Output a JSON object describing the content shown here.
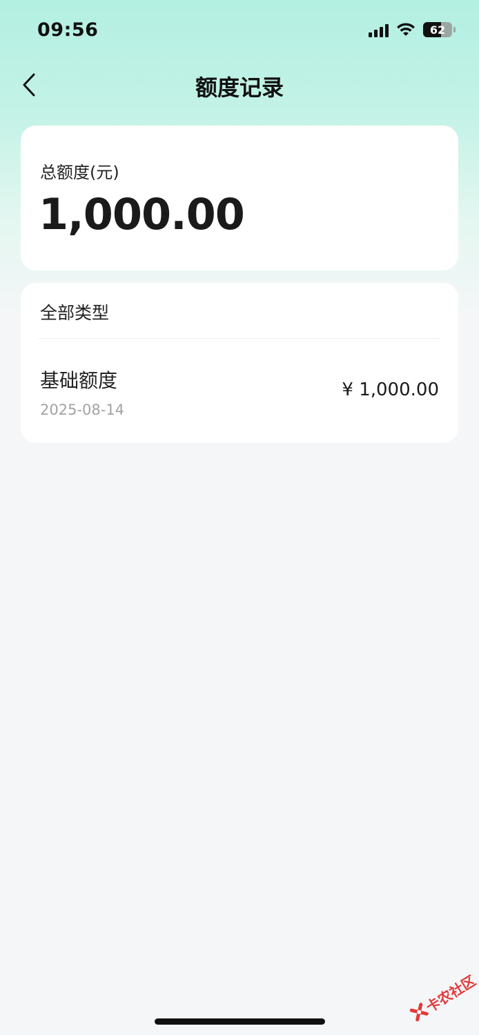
{
  "status_bar": {
    "time": "09:56",
    "battery_level": "62",
    "icons": [
      "signal-icon",
      "wifi-icon",
      "battery-icon"
    ]
  },
  "nav": {
    "back_icon": "chevron-left-icon",
    "title": "额度记录"
  },
  "total": {
    "label": "总额度(元)",
    "amount": "1,000.00"
  },
  "records": {
    "filter_label": "全部类型",
    "items": [
      {
        "name": "基础额度",
        "date": "2025-08-14",
        "amount": "¥ 1,000.00"
      }
    ]
  },
  "watermark": {
    "text": "卡农社区"
  },
  "colors": {
    "header_gradient_top": "#b3f0e2",
    "page_background": "#f5f6f8",
    "card_background": "#ffffff",
    "date_text": "#a2a2a2",
    "watermark": "#e13a3a"
  }
}
